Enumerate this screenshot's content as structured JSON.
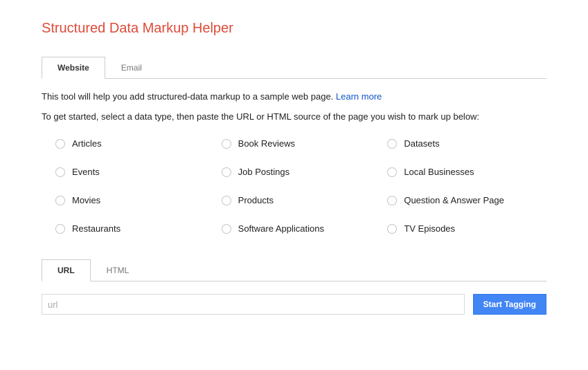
{
  "title": "Structured Data Markup Helper",
  "tabs": {
    "website": "Website",
    "email": "Email"
  },
  "intro": "This tool will help you add structured-data markup to a sample web page. ",
  "learnMore": "Learn more",
  "instruction": "To get started, select a data type, then paste the URL or HTML source of the page you wish to mark up below:",
  "options": {
    "articles": "Articles",
    "bookReviews": "Book Reviews",
    "datasets": "Datasets",
    "events": "Events",
    "jobPostings": "Job Postings",
    "localBusinesses": "Local Businesses",
    "movies": "Movies",
    "products": "Products",
    "qaPage": "Question & Answer Page",
    "restaurants": "Restaurants",
    "softwareApps": "Software Applications",
    "tvEpisodes": "TV Episodes"
  },
  "inputTabs": {
    "url": "URL",
    "html": "HTML"
  },
  "urlPlaceholder": "url",
  "startButton": "Start Tagging"
}
